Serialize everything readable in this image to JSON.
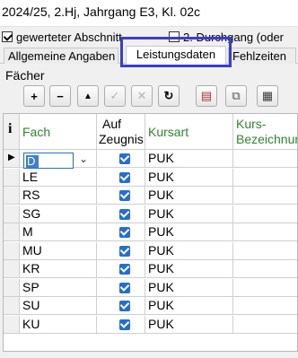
{
  "window": {
    "title": "2024/25, 2.Hj, Jahrgang E3, Kl. 02c"
  },
  "options": {
    "gewerteter_label": "gewerteter Abschnitt",
    "gewerteter_checked": true,
    "durchgang_label": "2. Durchgang (oder",
    "durchgang_checked": false
  },
  "tabs": [
    {
      "label": "Allgemeine Angaben",
      "active": false
    },
    {
      "label": "Leistungsdaten",
      "active": true
    },
    {
      "label": "Fehlzeiten",
      "active": false
    }
  ],
  "section": {
    "title": "Fächer"
  },
  "toolbar": {
    "buttons": [
      {
        "name": "add",
        "glyph": "+",
        "icon": "plus-icon",
        "enabled": true
      },
      {
        "name": "delete",
        "glyph": "−",
        "icon": "minus-icon",
        "enabled": true
      },
      {
        "name": "up",
        "glyph": "▲",
        "icon": "triangle-up-icon",
        "enabled": true
      },
      {
        "name": "confirm",
        "glyph": "✓",
        "icon": "check-icon",
        "enabled": false
      },
      {
        "name": "cancel",
        "glyph": "✕",
        "icon": "cancel-icon",
        "enabled": false
      },
      {
        "name": "refresh",
        "glyph": "↻",
        "icon": "refresh-icon",
        "enabled": true
      },
      {
        "name": "export",
        "glyph": "▤",
        "icon": "export-icon",
        "enabled": true
      },
      {
        "name": "copy",
        "glyph": "⧉",
        "icon": "copy-icon",
        "enabled": true
      },
      {
        "name": "form",
        "glyph": "▦",
        "icon": "form-icon",
        "enabled": true
      }
    ]
  },
  "table": {
    "info_label": "i",
    "headers": {
      "fach": "Fach",
      "auf_zeugnis_1": "Auf",
      "auf_zeugnis_2": "Zeugnis",
      "kursart": "Kursart",
      "kurs_bez_1": "Kurs-",
      "kurs_bez_2": "Bezeichnung"
    },
    "rows": [
      {
        "fach": "D",
        "auf_zeugnis": true,
        "kursart": "PUK",
        "kurs": ""
      },
      {
        "fach": "LE",
        "auf_zeugnis": true,
        "kursart": "PUK",
        "kurs": ""
      },
      {
        "fach": "RS",
        "auf_zeugnis": true,
        "kursart": "PUK",
        "kurs": ""
      },
      {
        "fach": "SG",
        "auf_zeugnis": true,
        "kursart": "PUK",
        "kurs": ""
      },
      {
        "fach": "M",
        "auf_zeugnis": true,
        "kursart": "PUK",
        "kurs": ""
      },
      {
        "fach": "MU",
        "auf_zeugnis": true,
        "kursart": "PUK",
        "kurs": ""
      },
      {
        "fach": "KR",
        "auf_zeugnis": true,
        "kursart": "PUK",
        "kurs": ""
      },
      {
        "fach": "SP",
        "auf_zeugnis": true,
        "kursart": "PUK",
        "kurs": ""
      },
      {
        "fach": "SU",
        "auf_zeugnis": true,
        "kursart": "PUK",
        "kurs": ""
      },
      {
        "fach": "KU",
        "auf_zeugnis": true,
        "kursart": "PUK",
        "kurs": ""
      }
    ]
  },
  "colors": {
    "header_green": "#2a8a2a",
    "checkbox_blue": "#1f6fd6",
    "tab_highlight": "#3b3bd6"
  }
}
